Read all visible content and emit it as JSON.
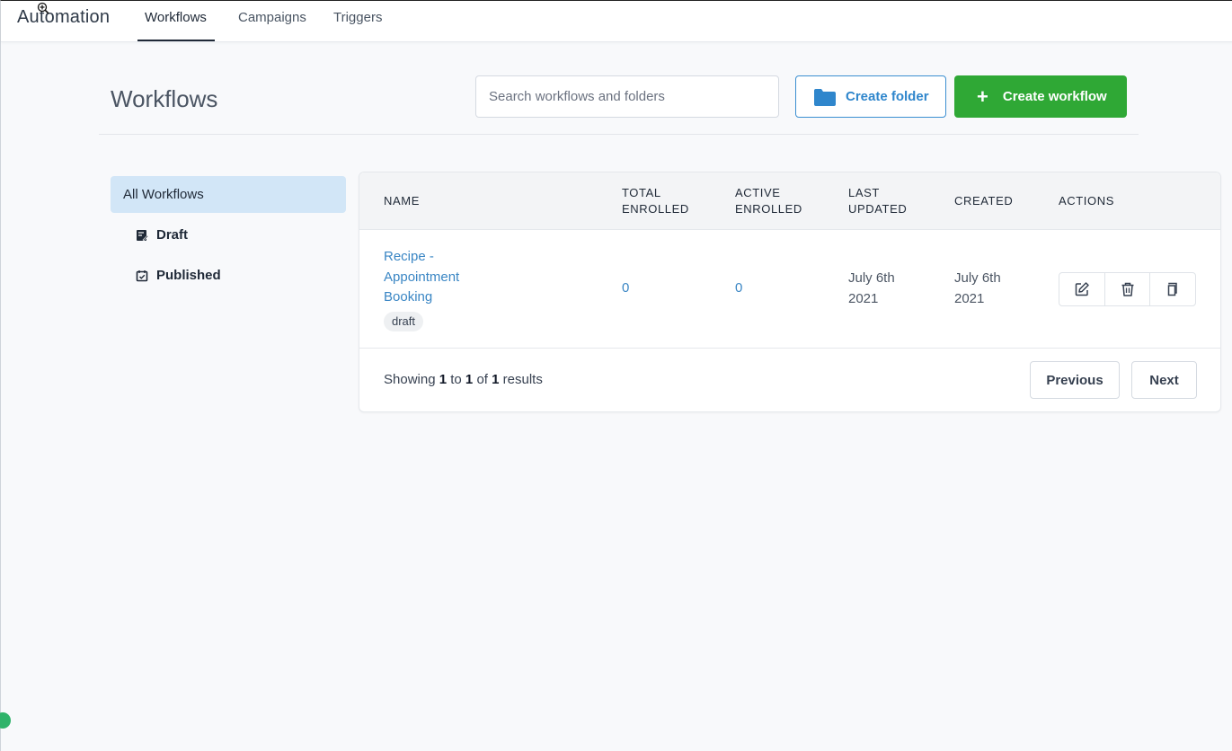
{
  "header": {
    "app_title": "Automation",
    "tabs": [
      {
        "label": "Workflows",
        "active": true
      },
      {
        "label": "Campaigns",
        "active": false
      },
      {
        "label": "Triggers",
        "active": false
      }
    ]
  },
  "toolbar": {
    "page_title": "Workflows",
    "search_placeholder": "Search workflows and folders",
    "create_folder_label": "Create folder",
    "create_workflow_label": "Create workflow",
    "create_workflow_icon": "+"
  },
  "sidebar": {
    "items": [
      {
        "label": "All Workflows",
        "icon": null,
        "active": true
      },
      {
        "label": "Draft",
        "icon": "draft-icon",
        "active": false
      },
      {
        "label": "Published",
        "icon": "published-icon",
        "active": false
      }
    ]
  },
  "table": {
    "columns": {
      "name": "NAME",
      "total_enrolled_1": "TOTAL",
      "total_enrolled_2": "ENROLLED",
      "active_enrolled_1": "ACTIVE",
      "active_enrolled_2": "ENROLLED",
      "last_updated_1": "LAST",
      "last_updated_2": "UPDATED",
      "created": "CREATED",
      "actions": "ACTIONS"
    },
    "rows": [
      {
        "name_line1": "Recipe -",
        "name_line2": "Appointment",
        "name_line3": "Booking",
        "status": "draft",
        "total_enrolled": "0",
        "active_enrolled": "0",
        "last_updated_1": "July 6th",
        "last_updated_2": "2021",
        "created_1": "July 6th",
        "created_2": "2021",
        "actions": [
          "edit-icon",
          "trash-icon",
          "copy-icon"
        ]
      }
    ]
  },
  "pagination": {
    "showing": "Showing",
    "from": "1",
    "to_word": "to",
    "to": "1",
    "of_word": "of",
    "total": "1",
    "results_word": "results",
    "previous_label": "Previous",
    "next_label": "Next"
  },
  "colors": {
    "accent_blue": "#3a86c4",
    "create_green": "#2fa835",
    "active_sidebar": "#d2e6f7"
  }
}
